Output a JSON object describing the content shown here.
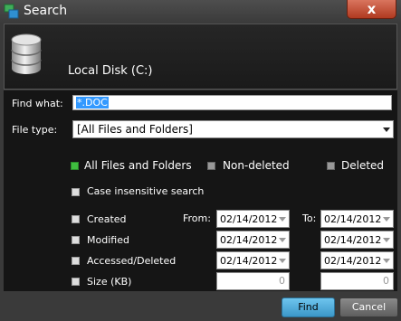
{
  "window": {
    "title": "Search",
    "close_glyph": "x"
  },
  "header": {
    "disk_label": "Local Disk (C:)"
  },
  "form": {
    "find_what_label": "Find what:",
    "find_what_value": "*.DOC",
    "file_type_label": "File type:",
    "file_type_value": "[All Files and Folders]",
    "radios": [
      {
        "label": "All Files and Folders",
        "selected": true
      },
      {
        "label": "Non-deleted",
        "selected": false
      },
      {
        "label": "Deleted",
        "selected": false
      }
    ],
    "case_insensitive_label": "Case insensitive search",
    "from_label": "From:",
    "to_label": "To:",
    "rows": [
      {
        "label": "Created",
        "from": "02/14/2012",
        "to": "02/14/2012"
      },
      {
        "label": "Modified",
        "from": "02/14/2012",
        "to": "02/14/2012"
      },
      {
        "label": "Accessed/Deleted",
        "from": "02/14/2012",
        "to": "02/14/2012"
      }
    ],
    "size": {
      "label": "Size (KB)",
      "from": "0",
      "to": "0"
    }
  },
  "footer": {
    "find_label": "Find",
    "cancel_label": "Cancel"
  }
}
